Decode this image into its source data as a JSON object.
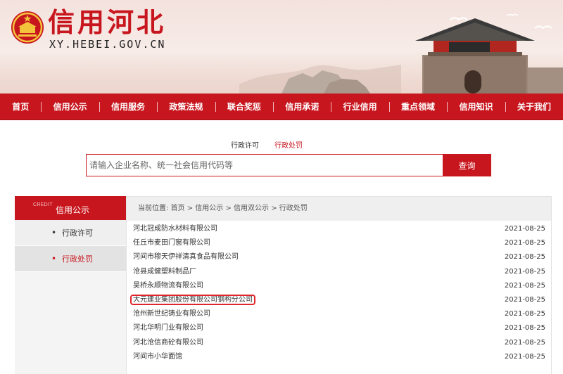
{
  "header": {
    "title": "信用河北",
    "domain": "XY.HEBEI.GOV.CN",
    "emblem_icon": "national-emblem-icon",
    "brand_color": "#c8161e"
  },
  "nav": {
    "items": [
      {
        "label": "首页"
      },
      {
        "label": "信用公示"
      },
      {
        "label": "信用服务"
      },
      {
        "label": "政策法规"
      },
      {
        "label": "联合奖惩"
      },
      {
        "label": "信用承诺"
      },
      {
        "label": "行业信用"
      },
      {
        "label": "重点领域"
      },
      {
        "label": "信用知识"
      },
      {
        "label": "关于我们"
      }
    ]
  },
  "search": {
    "tabs": [
      {
        "label": "行政许可",
        "active": false
      },
      {
        "label": "行政处罚",
        "active": true
      }
    ],
    "placeholder": "请输入企业名称、统一社会信用代码等",
    "button_label": "查询"
  },
  "sidebar": {
    "head_en": "CREDIT",
    "head_label": "信用公示",
    "items": [
      {
        "label": "行政许可",
        "active": false
      },
      {
        "label": "行政处罚",
        "active": true
      }
    ]
  },
  "main": {
    "breadcrumb": "当前位置: 首页 > 信用公示 > 信用双公示 > 行政处罚",
    "rows": [
      {
        "name": "河北冠成防水材料有限公司",
        "date": "2021-08-25"
      },
      {
        "name": "任丘市麦田门窗有限公司",
        "date": "2021-08-25"
      },
      {
        "name": "河间市穆天伊祥清真食品有限公司",
        "date": "2021-08-25"
      },
      {
        "name": "沧县成健塑料制品厂",
        "date": "2021-08-25"
      },
      {
        "name": "昊桥永顺物流有限公司",
        "date": "2021-08-25"
      },
      {
        "name": "大元建业集团股份有限公司钢构分公司",
        "date": "2021-08-25",
        "highlight": true
      },
      {
        "name": "沧州新世纪铸业有限公司",
        "date": "2021-08-25"
      },
      {
        "name": "河北华明门业有限公司",
        "date": "2021-08-25"
      },
      {
        "name": "河北沧信商砼有限公司",
        "date": "2021-08-25"
      },
      {
        "name": "河间市小华面馆",
        "date": "2021-08-25"
      }
    ]
  }
}
